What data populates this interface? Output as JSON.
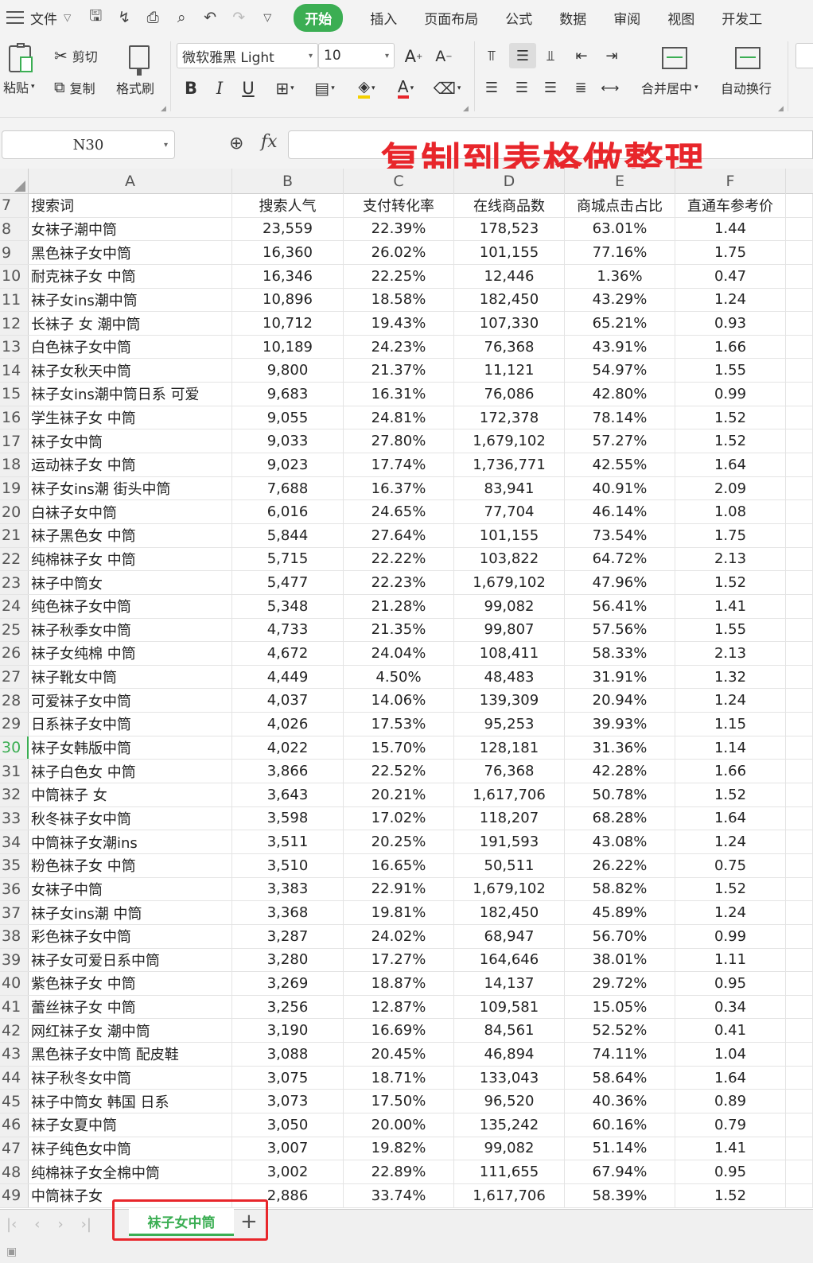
{
  "menu": {
    "file": "文件",
    "tabs": [
      "开始",
      "插入",
      "页面布局",
      "公式",
      "数据",
      "审阅",
      "视图",
      "开发工"
    ]
  },
  "ribbon": {
    "paste": "粘贴",
    "cut": "剪切",
    "copy": "复制",
    "format_painter": "格式刷",
    "font_name": "微软雅黑 Light",
    "font_size": "10",
    "bold": "B",
    "italic": "I",
    "underline": "U",
    "merge_center": "合并居中",
    "wrap_text": "自动换行"
  },
  "formula_bar": {
    "name_box": "N30",
    "fx": "fx",
    "value": ""
  },
  "annotation": "复制到表格做整理",
  "grid": {
    "columns": [
      "A",
      "B",
      "C",
      "D",
      "E",
      "F"
    ],
    "selected_row": "30",
    "rows": [
      [
        "7",
        "搜索词",
        "搜索人气",
        "支付转化率",
        "在线商品数",
        "商城点击占比",
        "直通车参考价"
      ],
      [
        "8",
        "女袜子潮中筒",
        "23,559",
        "22.39%",
        "178,523",
        "63.01%",
        "1.44"
      ],
      [
        "9",
        "黑色袜子女中筒",
        "16,360",
        "26.02%",
        "101,155",
        "77.16%",
        "1.75"
      ],
      [
        "10",
        "耐克袜子女 中筒",
        "16,346",
        "22.25%",
        "12,446",
        "1.36%",
        "0.47"
      ],
      [
        "11",
        "袜子女ins潮中筒",
        "10,896",
        "18.58%",
        "182,450",
        "43.29%",
        "1.24"
      ],
      [
        "12",
        "长袜子 女 潮中筒",
        "10,712",
        "19.43%",
        "107,330",
        "65.21%",
        "0.93"
      ],
      [
        "13",
        "白色袜子女中筒",
        "10,189",
        "24.23%",
        "76,368",
        "43.91%",
        "1.66"
      ],
      [
        "14",
        "袜子女秋天中筒",
        "9,800",
        "21.37%",
        "11,121",
        "54.97%",
        "1.55"
      ],
      [
        "15",
        "袜子女ins潮中筒日系 可爱",
        "9,683",
        "16.31%",
        "76,086",
        "42.80%",
        "0.99"
      ],
      [
        "16",
        "学生袜子女 中筒",
        "9,055",
        "24.81%",
        "172,378",
        "78.14%",
        "1.52"
      ],
      [
        "17",
        "袜子女中筒",
        "9,033",
        "27.80%",
        "1,679,102",
        "57.27%",
        "1.52"
      ],
      [
        "18",
        "运动袜子女 中筒",
        "9,023",
        "17.74%",
        "1,736,771",
        "42.55%",
        "1.64"
      ],
      [
        "19",
        "袜子女ins潮 街头中筒",
        "7,688",
        "16.37%",
        "83,941",
        "40.91%",
        "2.09"
      ],
      [
        "20",
        "白袜子女中筒",
        "6,016",
        "24.65%",
        "77,704",
        "46.14%",
        "1.08"
      ],
      [
        "21",
        "袜子黑色女 中筒",
        "5,844",
        "27.64%",
        "101,155",
        "73.54%",
        "1.75"
      ],
      [
        "22",
        "纯棉袜子女 中筒",
        "5,715",
        "22.22%",
        "103,822",
        "64.72%",
        "2.13"
      ],
      [
        "23",
        "袜子中筒女",
        "5,477",
        "22.23%",
        "1,679,102",
        "47.96%",
        "1.52"
      ],
      [
        "24",
        "纯色袜子女中筒",
        "5,348",
        "21.28%",
        "99,082",
        "56.41%",
        "1.41"
      ],
      [
        "25",
        "袜子秋季女中筒",
        "4,733",
        "21.35%",
        "99,807",
        "57.56%",
        "1.55"
      ],
      [
        "26",
        "袜子女纯棉 中筒",
        "4,672",
        "24.04%",
        "108,411",
        "58.33%",
        "2.13"
      ],
      [
        "27",
        "袜子靴女中筒",
        "4,449",
        "4.50%",
        "48,483",
        "31.91%",
        "1.32"
      ],
      [
        "28",
        "可爱袜子女中筒",
        "4,037",
        "14.06%",
        "139,309",
        "20.94%",
        "1.24"
      ],
      [
        "29",
        "日系袜子女中筒",
        "4,026",
        "17.53%",
        "95,253",
        "39.93%",
        "1.15"
      ],
      [
        "30",
        "袜子女韩版中筒",
        "4,022",
        "15.70%",
        "128,181",
        "31.36%",
        "1.14"
      ],
      [
        "31",
        "袜子白色女 中筒",
        "3,866",
        "22.52%",
        "76,368",
        "42.28%",
        "1.66"
      ],
      [
        "32",
        "中筒袜子 女",
        "3,643",
        "20.21%",
        "1,617,706",
        "50.78%",
        "1.52"
      ],
      [
        "33",
        "秋冬袜子女中筒",
        "3,598",
        "17.02%",
        "118,207",
        "68.28%",
        "1.64"
      ],
      [
        "34",
        "中筒袜子女潮ins",
        "3,511",
        "20.25%",
        "191,593",
        "43.08%",
        "1.24"
      ],
      [
        "35",
        "粉色袜子女 中筒",
        "3,510",
        "16.65%",
        "50,511",
        "26.22%",
        "0.75"
      ],
      [
        "36",
        "女袜子中筒",
        "3,383",
        "22.91%",
        "1,679,102",
        "58.82%",
        "1.52"
      ],
      [
        "37",
        "袜子女ins潮 中筒",
        "3,368",
        "19.81%",
        "182,450",
        "45.89%",
        "1.24"
      ],
      [
        "38",
        "彩色袜子女中筒",
        "3,287",
        "24.02%",
        "68,947",
        "56.70%",
        "0.99"
      ],
      [
        "39",
        "袜子女可爱日系中筒",
        "3,280",
        "17.27%",
        "164,646",
        "38.01%",
        "1.11"
      ],
      [
        "40",
        "紫色袜子女 中筒",
        "3,269",
        "18.87%",
        "14,137",
        "29.72%",
        "0.95"
      ],
      [
        "41",
        "蕾丝袜子女 中筒",
        "3,256",
        "12.87%",
        "109,581",
        "15.05%",
        "0.34"
      ],
      [
        "42",
        "网红袜子女 潮中筒",
        "3,190",
        "16.69%",
        "84,561",
        "52.52%",
        "0.41"
      ],
      [
        "43",
        "黑色袜子女中筒 配皮鞋",
        "3,088",
        "20.45%",
        "46,894",
        "74.11%",
        "1.04"
      ],
      [
        "44",
        "袜子秋冬女中筒",
        "3,075",
        "18.71%",
        "133,043",
        "58.64%",
        "1.64"
      ],
      [
        "45",
        "袜子中筒女 韩国 日系",
        "3,073",
        "17.50%",
        "96,520",
        "40.36%",
        "0.89"
      ],
      [
        "46",
        "袜子女夏中筒",
        "3,050",
        "20.00%",
        "135,242",
        "60.16%",
        "0.79"
      ],
      [
        "47",
        "袜子纯色女中筒",
        "3,007",
        "19.82%",
        "99,082",
        "51.14%",
        "1.41"
      ],
      [
        "48",
        "纯棉袜子女全棉中筒",
        "3,002",
        "22.89%",
        "111,655",
        "67.94%",
        "0.95"
      ],
      [
        "49",
        "中筒袜子女",
        "2,886",
        "33.74%",
        "1,617,706",
        "58.39%",
        "1.52"
      ]
    ]
  },
  "sheets": {
    "active": "袜子女中筒",
    "add": "+"
  },
  "colors": {
    "accent": "#3bae53",
    "annotation": "#e8262b"
  }
}
